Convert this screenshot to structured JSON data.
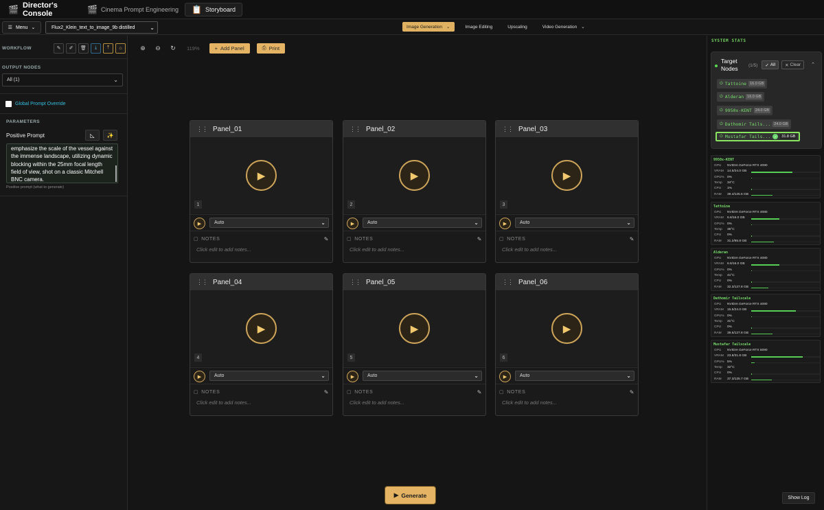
{
  "app": {
    "title": "Director's Console",
    "icon": "film-icon"
  },
  "tabs": [
    {
      "label": "Cinema Prompt Engineering",
      "icon": "film-icon"
    },
    {
      "label": "Storyboard",
      "icon": "clipboard-icon"
    }
  ],
  "toolbar": {
    "menu_label": "Menu",
    "model": "Flux2_Klein_text_to_image_9b distilled",
    "modes": [
      "Image Generation",
      "Image Editing",
      "Upscaling",
      "Video Generation"
    ]
  },
  "left": {
    "workflow_title": "WORKFLOW",
    "output_title": "OUTPUT NODES",
    "output_value": "All (1)",
    "override_label": "Global Prompt Override",
    "params_title": "PARAMETERS",
    "positive_label": "Positive Prompt",
    "prompt_text": "emphasize the scale of the vessel against the immense landscape, utilizing dynamic blocking within the 25mm focal length field of view, shot on a classic Mitchell BNC camera.",
    "prompt_hint": "Positive prompt (what to generate)"
  },
  "canvas": {
    "zoom": "119%",
    "add_panel": "Add Panel",
    "print": "Print",
    "panels": [
      {
        "name": "Panel_01",
        "num": "1",
        "select": "Auto",
        "notes_label": "NOTES",
        "notes_ph": "Click edit to add notes..."
      },
      {
        "name": "Panel_02",
        "num": "2",
        "select": "Auto",
        "notes_label": "NOTES",
        "notes_ph": "Click edit to add notes..."
      },
      {
        "name": "Panel_03",
        "num": "3",
        "select": "Auto",
        "notes_label": "NOTES",
        "notes_ph": "Click edit to add notes..."
      },
      {
        "name": "Panel_04",
        "num": "4",
        "select": "Auto",
        "notes_label": "NOTES",
        "notes_ph": "Click edit to add notes..."
      },
      {
        "name": "Panel_05",
        "num": "5",
        "select": "Auto",
        "notes_label": "NOTES",
        "notes_ph": "Click edit to add notes..."
      },
      {
        "name": "Panel_06",
        "num": "6",
        "select": "Auto",
        "notes_label": "NOTES",
        "notes_ph": "Click edit to add notes..."
      }
    ],
    "generate": "Generate"
  },
  "right": {
    "system_title": "SYSTEM STATS",
    "target_title": "Target Nodes",
    "target_count": "(1/5)",
    "all_label": "All",
    "clear_label": "Clear",
    "nodes": [
      {
        "name": "Tattoine",
        "gb": "16.0 GB"
      },
      {
        "name": "Alderan",
        "gb": "16.0 GB"
      },
      {
        "name": "9950x-KENT",
        "gb": "24.0 GB"
      },
      {
        "name": "Dathomir Tails...",
        "gb": "24.0 GB"
      },
      {
        "name": "Mustafar Tails...",
        "gb": "31.8 GB",
        "selected": true
      }
    ],
    "stats": [
      {
        "name": "9950x-KENT",
        "rows": [
          {
            "k": "GPU",
            "v": "NVIDIA GeForce RTX 4090",
            "pct": null
          },
          {
            "k": "VRAM",
            "v": "14.5/24.0 GB",
            "pct": 60
          },
          {
            "k": "GPU%",
            "v": "0%",
            "pct": 0
          },
          {
            "k": "Temp",
            "v": "34°C",
            "pct": null
          },
          {
            "k": "CPU",
            "v": "1%",
            "pct": 1
          },
          {
            "k": "RAM",
            "v": "39.4/125.5 GB",
            "pct": 31
          }
        ]
      },
      {
        "name": "Tattoine",
        "rows": [
          {
            "k": "GPU",
            "v": "NVIDIA GeForce RTX 4080",
            "pct": null
          },
          {
            "k": "VRAM",
            "v": "6.6/16.0 GB",
            "pct": 41
          },
          {
            "k": "GPU%",
            "v": "0%",
            "pct": 0
          },
          {
            "k": "Temp",
            "v": "36°C",
            "pct": null
          },
          {
            "k": "CPU",
            "v": "0%",
            "pct": 0
          },
          {
            "k": "RAM",
            "v": "31.2/95.8 GB",
            "pct": 33
          }
        ]
      },
      {
        "name": "Alderan",
        "rows": [
          {
            "k": "GPU",
            "v": "NVIDIA GeForce RTX 4080",
            "pct": null
          },
          {
            "k": "VRAM",
            "v": "6.6/16.0 GB",
            "pct": 41
          },
          {
            "k": "GPU%",
            "v": "0%",
            "pct": 0
          },
          {
            "k": "Temp",
            "v": "41°C",
            "pct": null
          },
          {
            "k": "CPU",
            "v": "0%",
            "pct": 0
          },
          {
            "k": "RAM",
            "v": "32.3/127.8 GB",
            "pct": 25
          }
        ]
      },
      {
        "name": "Dathomir Tailscale",
        "rows": [
          {
            "k": "GPU",
            "v": "NVIDIA GeForce RTX 4090",
            "pct": null
          },
          {
            "k": "VRAM",
            "v": "15.5/24.0 GB",
            "pct": 65
          },
          {
            "k": "GPU%",
            "v": "0%",
            "pct": 0
          },
          {
            "k": "Temp",
            "v": "31°C",
            "pct": null
          },
          {
            "k": "CPU",
            "v": "0%",
            "pct": 0
          },
          {
            "k": "RAM",
            "v": "39.5/127.8 GB",
            "pct": 31
          }
        ]
      },
      {
        "name": "Mustafar Tailscale",
        "rows": [
          {
            "k": "GPU",
            "v": "NVIDIA GeForce RTX 5090",
            "pct": null
          },
          {
            "k": "VRAM",
            "v": "23.8/31.8 GB",
            "pct": 75
          },
          {
            "k": "GPU%",
            "v": "5%",
            "pct": 5
          },
          {
            "k": "Temp",
            "v": "32°C",
            "pct": null
          },
          {
            "k": "CPU",
            "v": "0%",
            "pct": 0
          },
          {
            "k": "RAM",
            "v": "37.3/125.7 GB",
            "pct": 30
          }
        ]
      }
    ],
    "show_log": "Show Log"
  },
  "colors": {
    "accent": "#e4b464",
    "green": "#78df6c",
    "background": "#151515"
  }
}
